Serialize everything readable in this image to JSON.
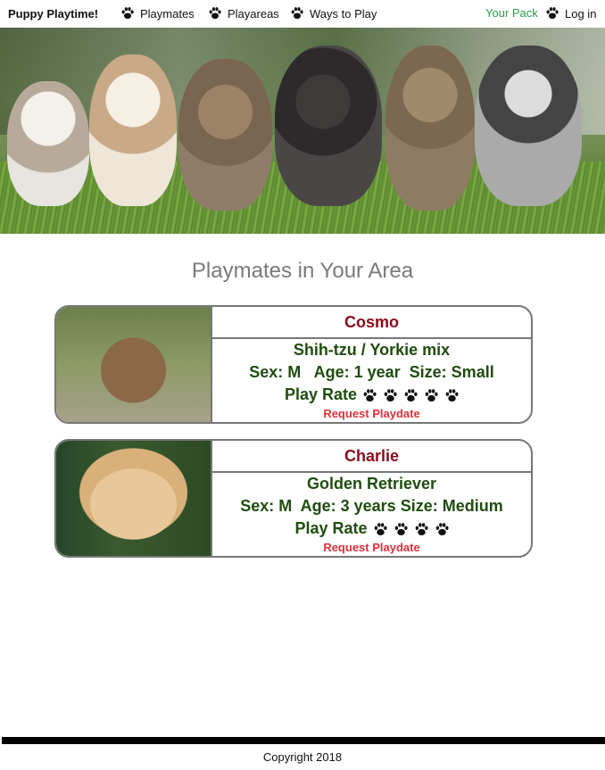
{
  "nav": {
    "brand": "Puppy Playtime!",
    "links": [
      "Playmates",
      "Playareas",
      "Ways to Play"
    ],
    "pack": "Your Pack",
    "login": "Log in"
  },
  "main": {
    "title": "Playmates in Your Area",
    "request_label": "Request Playdate"
  },
  "playmates": [
    {
      "name": "Cosmo",
      "breed": "Shih-tzu / Yorkie mix",
      "stats": "Sex: M   Age: 1 year  Size: Small",
      "play_rate_label": "Play Rate",
      "play_rate": 5
    },
    {
      "name": "Charlie",
      "breed": "Golden Retriever",
      "stats": "Sex: M  Age: 3 years Size: Medium",
      "play_rate_label": "Play Rate",
      "play_rate": 4
    }
  ],
  "footer": {
    "copyright": "Copyright 2018"
  },
  "colors": {
    "accent_green": "#2e9b4a",
    "name_red": "#8b0a1a",
    "info_green": "#1f4d0e",
    "request_red": "#e0303a"
  },
  "icons": {
    "paw": "paw-icon"
  }
}
